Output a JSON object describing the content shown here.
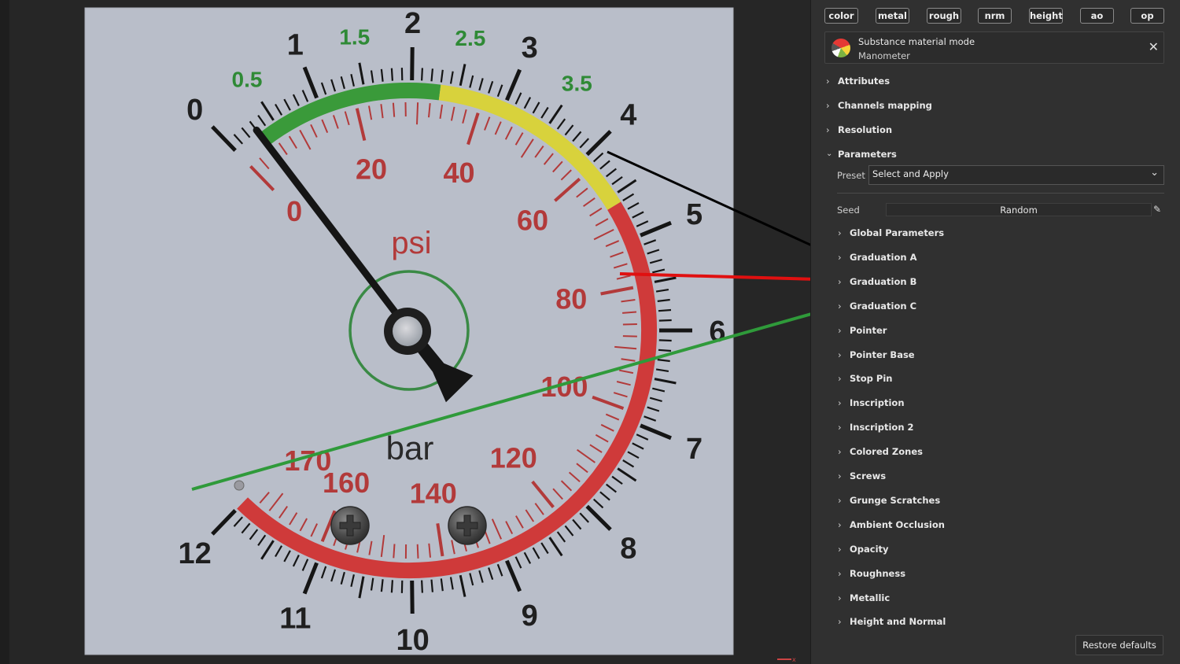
{
  "channels": [
    "color",
    "metal",
    "rough",
    "nrm",
    "height",
    "ao",
    "op"
  ],
  "mode": {
    "title": "Substance material mode",
    "subtitle": "Manometer",
    "close_icon": "close-icon"
  },
  "sections": {
    "attributes": "Attributes",
    "channels_mapping": "Channels mapping",
    "resolution": "Resolution",
    "parameters": "Parameters"
  },
  "preset": {
    "label": "Preset",
    "value": "Select and Apply"
  },
  "seed": {
    "label": "Seed",
    "value": "Random"
  },
  "parameter_groups": [
    "Global Parameters",
    "Graduation A",
    "Graduation B",
    "Graduation C",
    "Pointer",
    "Pointer Base",
    "Stop Pin",
    "Inscription",
    "Inscription 2",
    "Colored Zones",
    "Screws",
    "Grunge Scratches",
    "Ambient Occlusion",
    "Opacity",
    "Roughness",
    "Metallic",
    "Height and Normal"
  ],
  "restore_label": "Restore defaults",
  "gauge": {
    "bar_major": [
      "0",
      "1",
      "2",
      "3",
      "4",
      "5",
      "6",
      "7",
      "8",
      "9",
      "10",
      "11",
      "12"
    ],
    "bar_half": [
      "0.5",
      "1.5",
      "2.5",
      "3.5"
    ],
    "psi": [
      "0",
      "20",
      "40",
      "60",
      "80",
      "100",
      "120",
      "140",
      "160",
      "170"
    ],
    "unit_psi": "psi",
    "unit_bar": "bar",
    "pointer_value_bar": 0.3,
    "zones": [
      {
        "name": "green",
        "from": 0.3,
        "to": 2.3,
        "color": "#3a9a3a"
      },
      {
        "name": "yellow",
        "from": 2.3,
        "to": 4.6,
        "color": "#d8d23c"
      },
      {
        "name": "red",
        "from": 4.6,
        "to": 12,
        "color": "#cf3a3a"
      }
    ],
    "colors": {
      "face": "#b9bec9",
      "bar_text": "#1f1f1f",
      "half_text": "#2f8a36",
      "psi_text": "#b23a3a",
      "ring": "#3a8a45"
    }
  },
  "annotations": [
    {
      "name": "arrow-black",
      "color": "#000000",
      "target": "Graduation A"
    },
    {
      "name": "arrow-red",
      "color": "#e01010",
      "target": "Graduation B"
    },
    {
      "name": "arrow-green",
      "color": "#2f9a3a",
      "target": "Graduation C"
    }
  ]
}
